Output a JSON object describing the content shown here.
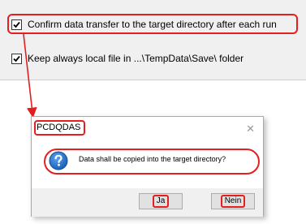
{
  "settings": {
    "confirm_transfer_label": "Confirm data transfer to the target directory after each run",
    "confirm_transfer_checked": true,
    "keep_local_label": "Keep always local file in ...\\TempData\\Save\\ folder",
    "keep_local_checked": true
  },
  "dialog": {
    "title": "PCDQDAS",
    "close_glyph": "✕",
    "message": "Data shall be copied into the target directory?",
    "icon": "question-icon",
    "yes_label": "Ja",
    "no_label": "Nein"
  },
  "colors": {
    "highlight": "#e41f1f",
    "panel_bg": "#f0f0f0",
    "question_icon": "#1b62b9"
  },
  "annotation": {
    "arrow": "callout-arrow"
  }
}
